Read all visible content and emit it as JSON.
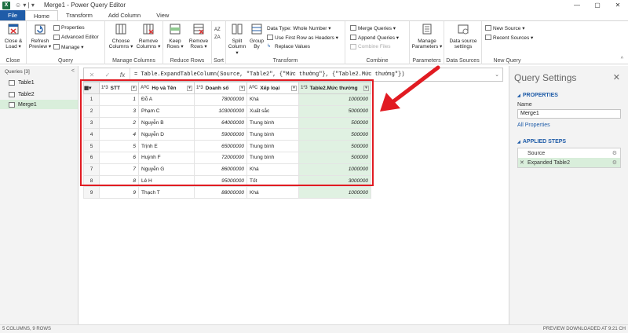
{
  "window": {
    "title": "Merge1 - Power Query Editor",
    "app_icon_color": "#1d6f42",
    "minimize": "—",
    "restore": "▢",
    "close": "✕"
  },
  "tabs": [
    "File",
    "Home",
    "Transform",
    "Add Column",
    "View"
  ],
  "ribbon": {
    "close_group": {
      "close_load": "Close & Load ▾",
      "label": "Close"
    },
    "query_group": {
      "refresh": "Refresh Preview ▾",
      "properties": "Properties",
      "advanced_editor": "Advanced Editor",
      "manage": "Manage ▾",
      "label": "Query"
    },
    "manage_columns": {
      "choose": "Choose Columns ▾",
      "remove": "Remove Columns ▾",
      "label": "Manage Columns"
    },
    "reduce_rows": {
      "keep": "Keep Rows ▾",
      "remove": "Remove Rows ▾",
      "label": "Reduce Rows"
    },
    "sort": {
      "label": "Sort"
    },
    "transform": {
      "split": "Split Column ▾",
      "group": "Group By",
      "data_type": "Data Type: Whole Number ▾",
      "first_row": "Use First Row as Headers ▾",
      "replace": "Replace Values",
      "label": "Transform"
    },
    "combine": {
      "merge": "Merge Queries ▾",
      "append": "Append Queries ▾",
      "combine_files": "Combine Files",
      "label": "Combine"
    },
    "parameters": {
      "manage": "Manage Parameters ▾",
      "label": "Parameters"
    },
    "data_sources": {
      "settings": "Data source settings",
      "label": "Data Sources"
    },
    "new_query": {
      "new_source": "New Source ▾",
      "recent": "Recent Sources ▾",
      "label": "New Query"
    }
  },
  "queries": {
    "header": "Queries [3]",
    "items": [
      "Table1",
      "Table2",
      "Merge1"
    ]
  },
  "formula": "= Table.ExpandTableColumn(Source, \"Table2\", {\"Mức thưởng\"}, {\"Table2.Mức thưởng\"})",
  "table": {
    "columns": [
      {
        "type": "1²3",
        "name": "STT"
      },
      {
        "type": "AᴮC",
        "name": "Họ và Tên"
      },
      {
        "type": "1²3",
        "name": "Doanh số"
      },
      {
        "type": "AᴮC",
        "name": "Xếp loại"
      },
      {
        "type": "1²3",
        "name": "Table2.Mức thưởng"
      }
    ],
    "rows": [
      [
        "1",
        "1",
        "Đỗ A",
        "78000000",
        "Khá",
        "1000000"
      ],
      [
        "2",
        "3",
        "Phạm C",
        "103000000",
        "Xuất sắc",
        "5000000"
      ],
      [
        "3",
        "2",
        "Nguyễn B",
        "64000000",
        "Trung bình",
        "500000"
      ],
      [
        "4",
        "4",
        "Nguyễn D",
        "59000000",
        "Trung bình",
        "500000"
      ],
      [
        "5",
        "5",
        "Trịnh E",
        "65000000",
        "Trung bình",
        "500000"
      ],
      [
        "6",
        "6",
        "Huỳnh F",
        "72000000",
        "Trung bình",
        "500000"
      ],
      [
        "7",
        "7",
        "Nguyễn G",
        "86000000",
        "Khá",
        "1000000"
      ],
      [
        "8",
        "8",
        "Lê H",
        "95000000",
        "Tốt",
        "3000000"
      ],
      [
        "9",
        "9",
        "Thạch T",
        "88000000",
        "Khá",
        "1000000"
      ]
    ]
  },
  "settings": {
    "title": "Query Settings",
    "properties_header": "PROPERTIES",
    "name_label": "Name",
    "name_value": "Merge1",
    "all_properties": "All Properties",
    "applied_steps_header": "APPLIED STEPS",
    "steps": [
      "Source",
      "Expanded Table2"
    ]
  },
  "status": {
    "left": "5 COLUMNS, 9 ROWS",
    "right": "PREVIEW DOWNLOADED AT 9:21 CH"
  },
  "colors": {
    "accent": "#1f5ca8",
    "highlight": "#e11b22",
    "selection": "#d9eedb"
  }
}
